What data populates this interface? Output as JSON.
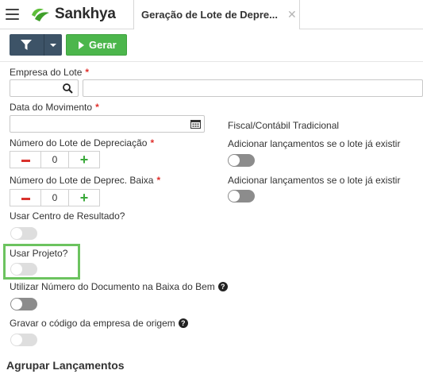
{
  "app": {
    "logo_text": "Sankhya"
  },
  "tab": {
    "title": "Geração de Lote de Depre...",
    "close": "✕"
  },
  "toolbar": {
    "gerar_label": "Gerar"
  },
  "form": {
    "empresa_label": "Empresa do Lote",
    "data_label": "Data do Movimento",
    "numero_lote_label": "Número do Lote de Depreciação",
    "numero_lote_value": "0",
    "numero_baixa_label": "Número do Lote de Deprec. Baixa",
    "numero_baixa_value": "0",
    "fiscal_label": "Fiscal/Contábil Tradicional",
    "adicionar_label_1": "Adicionar lançamentos se o lote já existir",
    "adicionar_label_2": "Adicionar lançamentos se o lote já existir",
    "centro_resultado_label": "Usar Centro de Resultado?",
    "usar_projeto_label": "Usar Projeto?",
    "utilizar_numero_label": "Utilizar Número do Documento na Baixa do Bem",
    "gravar_codigo_label": "Gravar o código da empresa de origem",
    "required_mark": "*",
    "help_mark": "?"
  },
  "section": {
    "agrupar_title": "Agrupar Lançamentos"
  },
  "toggles": {
    "adicionar_1": false,
    "adicionar_2": false,
    "centro_resultado": false,
    "usar_projeto": false,
    "utilizar_numero": false,
    "gravar_codigo": false
  },
  "colors": {
    "accent_green": "#4cb64c",
    "toolbar_dark": "#3d5367",
    "required": "#e0302c",
    "highlight": "#6cc35f"
  }
}
